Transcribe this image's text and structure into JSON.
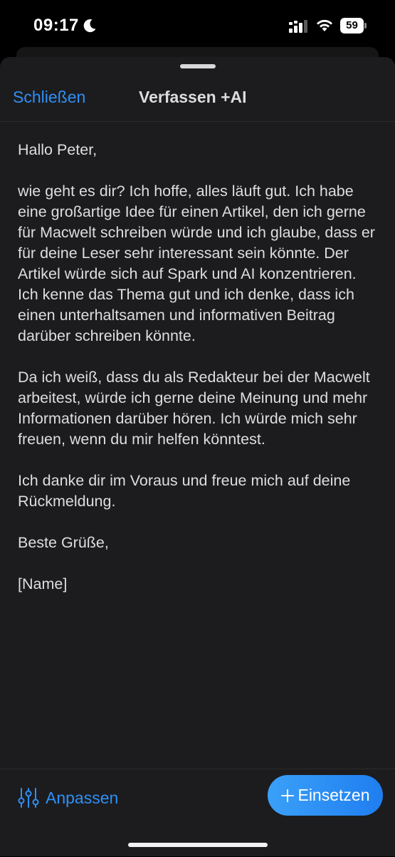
{
  "status_bar": {
    "time": "09:17",
    "battery": "59"
  },
  "header": {
    "close_label": "Schließen",
    "title": "Verfassen +AI"
  },
  "email": {
    "paragraphs": [
      "Hallo Peter,",
      "wie geht es dir? Ich hoffe, alles läuft gut. Ich habe eine großartige Idee für einen Artikel, den ich gerne für Macwelt schreiben würde und ich glaube, dass er für deine Leser sehr interessant sein könnte. Der Artikel würde sich auf Spark und AI konzentrieren. Ich kenne das Thema gut und ich denke, dass ich einen unterhaltsamen und informativen Beitrag darüber schreiben könnte.",
      "Da ich weiß, dass du als Redakteur bei der Macwelt arbeitest, würde ich gerne deine Meinung und mehr Informationen darüber hören. Ich würde mich sehr freuen, wenn du mir helfen könntest.",
      "Ich danke dir im Voraus und freue mich auf deine Rückmeldung.",
      "Beste Grüße,",
      "[Name]"
    ]
  },
  "footer": {
    "adjust_label": "Anpassen",
    "insert_label": "Einsetzen"
  },
  "colors": {
    "accent": "#2f8ff5",
    "background": "#1c1c1e",
    "text": "#dedee0"
  },
  "icons": {
    "moon": "moon-icon",
    "signal": "signal-icon",
    "wifi": "wifi-icon",
    "sliders": "sliders-icon",
    "plus": "plus-icon"
  }
}
